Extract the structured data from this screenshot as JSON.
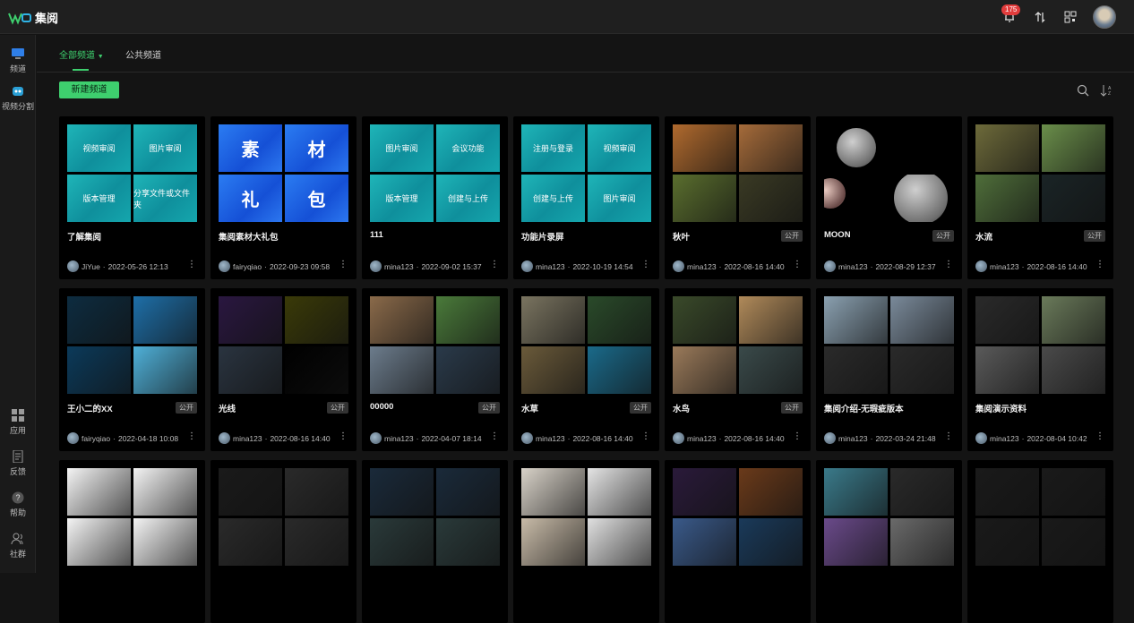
{
  "app": {
    "title": "集阅",
    "notification_count": "175"
  },
  "sidebar": {
    "items": [
      {
        "label": "频道",
        "icon": "monitor-icon"
      },
      {
        "label": "视频分割",
        "icon": "robot-icon"
      },
      {
        "label": "应用",
        "icon": "grid-icon"
      },
      {
        "label": "反馈",
        "icon": "document-icon"
      },
      {
        "label": "帮助",
        "icon": "help-icon"
      },
      {
        "label": "社群",
        "icon": "people-icon"
      }
    ]
  },
  "tabs": [
    {
      "label": "全部频道",
      "active": true
    },
    {
      "label": "公共频道",
      "active": false
    }
  ],
  "toolbar": {
    "new_channel": "新建频道"
  },
  "cards": [
    {
      "title": "了解集阅",
      "user": "JiYue",
      "time": "2022-05-26 12:13",
      "public": "",
      "tiles": [
        "视频审阅",
        "图片审阅",
        "版本管理",
        "分享文件或文件夹"
      ],
      "style": "teal"
    },
    {
      "title": "集阅素材大礼包",
      "user": "fairyqiao",
      "time": "2022-09-23 09:58",
      "public": "",
      "tiles": [
        "素",
        "材",
        "礼",
        "包"
      ],
      "style": "blue"
    },
    {
      "title": "111",
      "user": "mina123",
      "time": "2022-09-02 15:37",
      "public": "",
      "tiles": [
        "图片审阅",
        "会议功能",
        "版本管理",
        "创建与上传"
      ],
      "style": "teal"
    },
    {
      "title": "功能片录屏",
      "user": "mina123",
      "time": "2022-10-19 14:54",
      "public": "",
      "tiles": [
        "注册与登录",
        "视频审阅",
        "创建与上传",
        "图片审阅"
      ],
      "style": "teal"
    },
    {
      "title": "秋叶",
      "user": "mina123",
      "time": "2022-08-16 14:40",
      "public": "公开",
      "photos": [
        "#b06a2e",
        "#a56b3a",
        "#5a6e2e",
        "#3a3a24"
      ]
    },
    {
      "title": "MOON",
      "user": "mina123",
      "time": "2022-08-29 12:37",
      "public": "公开",
      "photos": [
        "moon",
        "black",
        "moon2",
        "moon3"
      ]
    },
    {
      "title": "水流",
      "user": "mina123",
      "time": "2022-08-16 14:40",
      "public": "公开",
      "photos": [
        "#6d6a3a",
        "#6a8e4a",
        "#4f6e3a",
        "#1a2426"
      ]
    },
    {
      "title": "王小二的XX",
      "user": "fairyqiao",
      "time": "2022-04-18 10:08",
      "public": "公开",
      "photos": [
        "#0d2c40",
        "#1e6fa8",
        "#0b3a5a",
        "#4fb0d8"
      ]
    },
    {
      "title": "光线",
      "user": "mina123",
      "time": "2022-08-16 14:40",
      "public": "公开",
      "photos": [
        "#2a1740",
        "#3a3a08",
        "#2a3440",
        "#000"
      ]
    },
    {
      "title": "00000",
      "user": "mina123",
      "time": "2022-04-07 18:14",
      "public": "公开",
      "photos": [
        "#8a6a4a",
        "#4a7a3a",
        "#6c7c8c",
        "#2a3a4a"
      ]
    },
    {
      "title": "水草",
      "user": "mina123",
      "time": "2022-08-16 14:40",
      "public": "公开",
      "photos": [
        "#7a7460",
        "#2a4a2a",
        "#6a5a3a",
        "#1a6a8a"
      ]
    },
    {
      "title": "水鸟",
      "user": "mina123",
      "time": "2022-08-16 14:40",
      "public": "公开",
      "photos": [
        "#3a4a2a",
        "#b08a5a",
        "#9a7a5a",
        "#3a4a4a"
      ]
    },
    {
      "title": "集阅介绍-无瑕疵版本",
      "user": "mina123",
      "time": "2022-03-24 21:48",
      "public": "",
      "photos": [
        "#8aa0b0",
        "#7a8a9a",
        "#2a2a2a",
        "#2a2a2a"
      ]
    },
    {
      "title": "集阅演示资料",
      "user": "mina123",
      "time": "2022-08-04 10:42",
      "public": "",
      "photos": [
        "#2a2a2a",
        "#6a7a5a",
        "#5a5a5a",
        "#4a4a4a"
      ]
    },
    {
      "title": "",
      "user": "",
      "time": "",
      "public": "",
      "photos": [
        "#f4f4f4",
        "#f4f4f4",
        "#f4f4f4",
        "#f4f4f4"
      ]
    },
    {
      "title": "",
      "user": "",
      "time": "",
      "public": "",
      "photos": [
        "#1a1a1a",
        "#2a2a2a",
        "#2a2a2a",
        "#2a2a2a"
      ]
    },
    {
      "title": "",
      "user": "",
      "time": "",
      "public": "",
      "photos": [
        "#1a2a3a",
        "#1a2a3a",
        "#2a3a3a",
        "#2a3a3a"
      ]
    },
    {
      "title": "",
      "user": "",
      "time": "",
      "public": "",
      "photos": [
        "#d8d2c8",
        "#e4e4e4",
        "#c8bba8",
        "#e0e0e0"
      ]
    },
    {
      "title": "",
      "user": "",
      "time": "",
      "public": "",
      "photos": [
        "#2a1a3a",
        "#6a3a1a",
        "#3a5a8a",
        "#1a3a5a"
      ]
    },
    {
      "title": "",
      "user": "",
      "time": "",
      "public": "",
      "photos": [
        "#3a7a8a",
        "#2a2a2a",
        "#6a4a8a",
        "#6a6a6a"
      ]
    },
    {
      "title": "",
      "user": "",
      "time": "",
      "public": "",
      "photos": [
        "#1a1a1a",
        "#1a1a1a",
        "#1a1a1a",
        "#1a1a1a"
      ]
    }
  ],
  "colors": {
    "accent": "#3ecf6e",
    "badge": "#e23c3c"
  }
}
